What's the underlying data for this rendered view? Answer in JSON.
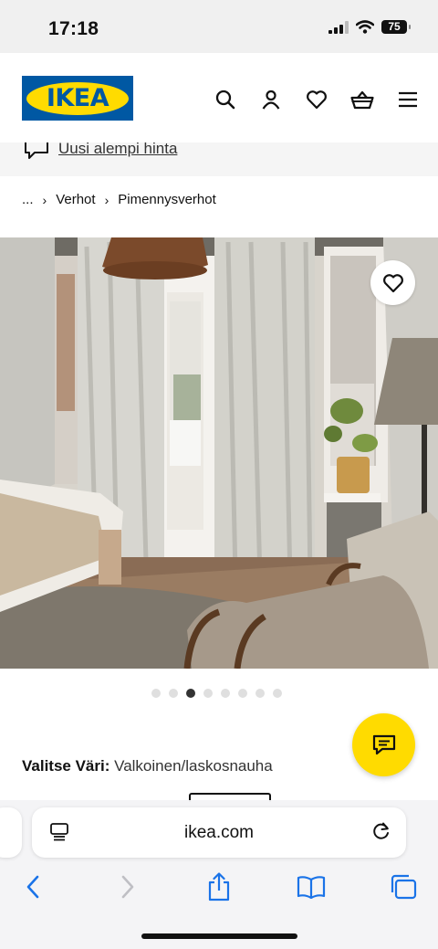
{
  "status_bar": {
    "time": "17:18",
    "battery": "75"
  },
  "header": {
    "logo_text": "IKEA"
  },
  "promo": {
    "text": "Uusi alempi hinta"
  },
  "breadcrumb": {
    "ellipsis": "...",
    "items": [
      "Verhot",
      "Pimennysverhot"
    ]
  },
  "gallery": {
    "dot_count": 8,
    "active_index": 2
  },
  "product": {
    "color_label": "Valitse Väri:",
    "color_value": "Valkoinen/laskosnauha"
  },
  "browser": {
    "url": "ikea.com"
  },
  "colors": {
    "ikea_blue": "#0058a3",
    "ikea_yellow": "#ffdb00",
    "ios_blue": "#1a73e8"
  }
}
